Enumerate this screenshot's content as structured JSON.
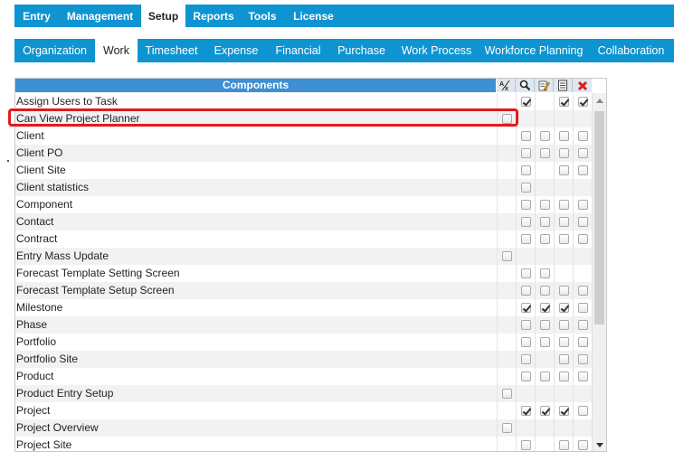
{
  "top_nav": [
    {
      "label": "Entry",
      "active": false
    },
    {
      "label": "Management",
      "active": false
    },
    {
      "label": "Setup",
      "active": true
    },
    {
      "label": "Reports",
      "active": false
    },
    {
      "label": "Tools",
      "active": false
    },
    {
      "label": "License",
      "active": false
    }
  ],
  "sub_nav": [
    {
      "label": "Organization",
      "active": false
    },
    {
      "label": "Work",
      "active": true
    },
    {
      "label": "Timesheet",
      "active": false
    },
    {
      "label": "Expense",
      "active": false
    },
    {
      "label": "Financial",
      "active": false
    },
    {
      "label": "Purchase",
      "active": false
    },
    {
      "label": "Work Process",
      "active": false
    },
    {
      "label": "Workforce Planning",
      "active": false
    },
    {
      "label": "Collaboration",
      "active": false
    }
  ],
  "grid": {
    "header": "Components",
    "columns": [
      "all-access-icon",
      "view-icon",
      "edit-icon",
      "add-icon",
      "delete-icon"
    ],
    "rows": [
      {
        "label": "Assign Users to Task",
        "cells": [
          null,
          true,
          null,
          true,
          true
        ]
      },
      {
        "label": "Can View Project Planner",
        "cells": [
          false,
          null,
          null,
          null,
          null
        ]
      },
      {
        "label": "Client",
        "cells": [
          null,
          false,
          false,
          false,
          false
        ]
      },
      {
        "label": "Client PO",
        "cells": [
          null,
          false,
          false,
          false,
          false
        ]
      },
      {
        "label": "Client Site",
        "cells": [
          null,
          false,
          null,
          false,
          false
        ]
      },
      {
        "label": "Client statistics",
        "cells": [
          null,
          false,
          null,
          null,
          null
        ]
      },
      {
        "label": "Component",
        "cells": [
          null,
          false,
          false,
          false,
          false
        ]
      },
      {
        "label": "Contact",
        "cells": [
          null,
          false,
          false,
          false,
          false
        ]
      },
      {
        "label": "Contract",
        "cells": [
          null,
          false,
          false,
          false,
          false
        ]
      },
      {
        "label": "Entry Mass Update",
        "cells": [
          false,
          null,
          null,
          null,
          null
        ]
      },
      {
        "label": "Forecast Template Setting Screen",
        "cells": [
          null,
          false,
          false,
          null,
          null
        ]
      },
      {
        "label": "Forecast Template Setup Screen",
        "cells": [
          null,
          false,
          false,
          false,
          false
        ]
      },
      {
        "label": "Milestone",
        "cells": [
          null,
          true,
          true,
          true,
          false
        ]
      },
      {
        "label": "Phase",
        "cells": [
          null,
          false,
          false,
          false,
          false
        ]
      },
      {
        "label": "Portfolio",
        "cells": [
          null,
          false,
          false,
          false,
          false
        ]
      },
      {
        "label": "Portfolio Site",
        "cells": [
          null,
          false,
          null,
          false,
          false
        ]
      },
      {
        "label": "Product",
        "cells": [
          null,
          false,
          false,
          false,
          false
        ]
      },
      {
        "label": "Product Entry Setup",
        "cells": [
          false,
          null,
          null,
          null,
          null
        ]
      },
      {
        "label": "Project",
        "cells": [
          null,
          true,
          true,
          true,
          false
        ]
      },
      {
        "label": "Project Overview",
        "cells": [
          false,
          null,
          null,
          null,
          null
        ]
      },
      {
        "label": "Project Site",
        "cells": [
          null,
          false,
          null,
          false,
          false
        ]
      }
    ]
  },
  "highlighted_row": "Can View Project Planner",
  "colors": {
    "nav": "#0f94d2",
    "header": "#3e8fd3",
    "highlight": "#e21b1b"
  }
}
